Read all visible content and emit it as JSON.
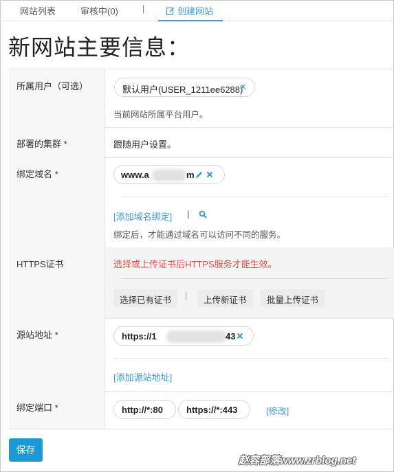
{
  "tabs": {
    "site_list": "网站列表",
    "reviewing": "审核中(0)",
    "separator": "|",
    "create_site": "创建网站"
  },
  "page_title": "新网站主要信息：",
  "fields": {
    "owner": {
      "label": "所属用户（可选）",
      "value": "默认用户(USER_1211ee6288)",
      "remove": "✕",
      "hint": "当前网站所属平台用户。"
    },
    "cluster": {
      "label": "部署的集群 *",
      "value": "跟随用户设置。"
    },
    "domain": {
      "label": "绑定域名 *",
      "value_prefix": "www.a",
      "value_suffix": "m",
      "add_link": "[添加域名绑定]",
      "separator": "|",
      "hint": "绑定后，才能通过域名可以访问不同的服务。"
    },
    "https": {
      "label": "HTTPS证书",
      "warning": "选择或上传证书后HTTPS服务才能生效。",
      "buttons": [
        "选择已有证书",
        "上传新证书",
        "批量上传证书"
      ],
      "separator": "|"
    },
    "origin": {
      "label": "源站地址 *",
      "value_prefix": "https://1",
      "value_suffix": "43",
      "add_link": "[添加源站地址]"
    },
    "ports": {
      "label": "绑定端口 *",
      "http": "http://*:80",
      "https": "https://*:443",
      "edit_link": "[修改]"
    }
  },
  "save_label": "保存",
  "watermark": "赵容部落www.zrblog.net",
  "colors": {
    "accent": "#3c9bd6",
    "save_button": "#1b98d6",
    "warning": "#e0504a"
  }
}
